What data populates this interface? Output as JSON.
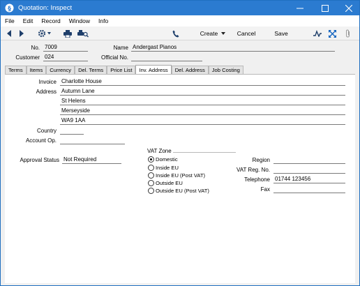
{
  "window": {
    "title": "Quotation: Inspect"
  },
  "menu": [
    "File",
    "Edit",
    "Record",
    "Window",
    "Info"
  ],
  "toolbar": {
    "create_label": "Create",
    "cancel_label": "Cancel",
    "save_label": "Save"
  },
  "header": {
    "no_label": "No.",
    "no_value": "7009",
    "name_label": "Name",
    "name_value": "Andergast Pianos",
    "customer_label": "Customer",
    "customer_value": "024",
    "official_label": "Official No.",
    "official_value": ""
  },
  "tabs": [
    "Terms",
    "Items",
    "Currency",
    "Del. Terms",
    "Price List",
    "Inv. Address",
    "Del. Address",
    "Job Costing"
  ],
  "active_tab": "Inv. Address",
  "inv_address": {
    "invoice_label": "Invoice",
    "invoice_value": "Charlotte House",
    "address_label": "Address",
    "address_lines": [
      "Autumn Lane",
      "St Helens",
      "Merseyside",
      "WA9 1AA"
    ],
    "country_label": "Country",
    "country_value": "",
    "account_label": "Account Op.",
    "account_value": "",
    "approval_label": "Approval Status",
    "approval_value": "Not Required",
    "vat_zone_label": "VAT Zone",
    "vat_zone_options": [
      "Domestic",
      "Inside EU",
      "Inside EU (Post VAT)",
      "Outside EU",
      "Outside EU (Post VAT)"
    ],
    "vat_zone_selected": "Domestic",
    "region_label": "Region",
    "region_value": "",
    "vat_reg_label": "VAT Reg. No.",
    "vat_reg_value": "",
    "telephone_label": "Telephone",
    "telephone_value": "01744 123456",
    "fax_label": "Fax",
    "fax_value": ""
  },
  "colors": {
    "titlebar": "#2b7bd0",
    "accent": "#1565c0"
  }
}
